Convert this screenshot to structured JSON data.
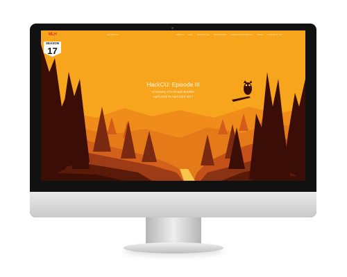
{
  "page": {
    "badge": {
      "logo_text": "MLH",
      "season_label": "SEASON",
      "season_number": "17"
    },
    "nav_left": "HackCU III",
    "nav_items": [
      "ABOUT",
      "FAQ",
      "SCHEDULE",
      "SPONSORS",
      "PREVIOUS EVENTS",
      "TEAM",
      "CONTACT US"
    ],
    "hero": {
      "title": "HackCU: Episode III",
      "subtitle": "University of Colorado Boulder",
      "dates": "April 22nd To April 23rd 2017"
    }
  },
  "colors": {
    "sky": "#f6a51c",
    "sun": "#fcd25a",
    "far_hills": "#f08c1a",
    "mid_hills": "#d4611b",
    "canyon": "#9c3b16",
    "foreground": "#3a0e07"
  }
}
